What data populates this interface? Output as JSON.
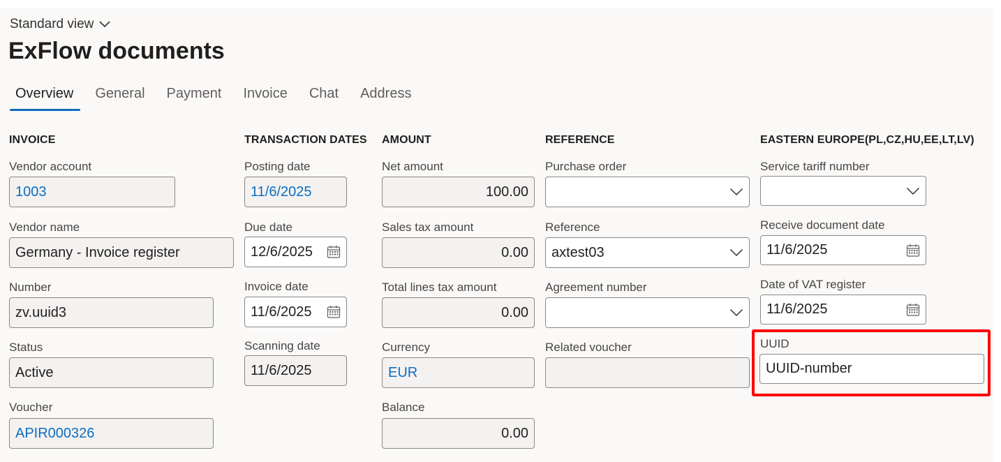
{
  "view": {
    "label": "Standard view",
    "icon": "chevron-down-icon"
  },
  "page_title": "ExFlow documents",
  "tabs": [
    "Overview",
    "General",
    "Payment",
    "Invoice",
    "Chat",
    "Address"
  ],
  "active_tab": "Overview",
  "sections": {
    "invoice": "INVOICE",
    "transaction_dates": "TRANSACTION DATES",
    "amount": "AMOUNT",
    "reference": "REFERENCE",
    "eastern_europe": "EASTERN EUROPE(PL,CZ,HU,EE,LT,LV)"
  },
  "invoice": {
    "vendor_account": {
      "label": "Vendor account",
      "value": "1003"
    },
    "vendor_name": {
      "label": "Vendor name",
      "value": "Germany - Invoice register"
    },
    "number": {
      "label": "Number",
      "value": "zv.uuid3"
    },
    "status": {
      "label": "Status",
      "value": "Active"
    },
    "voucher": {
      "label": "Voucher",
      "value": "APIR000326"
    }
  },
  "dates": {
    "posting_date": {
      "label": "Posting date",
      "value": "11/6/2025"
    },
    "due_date": {
      "label": "Due date",
      "value": "12/6/2025"
    },
    "invoice_date": {
      "label": "Invoice date",
      "value": "11/6/2025"
    },
    "scanning_date": {
      "label": "Scanning date",
      "value": "11/6/2025"
    }
  },
  "amount": {
    "net_amount": {
      "label": "Net amount",
      "value": "100.00"
    },
    "sales_tax_amount": {
      "label": "Sales tax amount",
      "value": "0.00"
    },
    "total_lines_tax_amount": {
      "label": "Total lines tax amount",
      "value": "0.00"
    },
    "currency": {
      "label": "Currency",
      "value": "EUR"
    },
    "balance": {
      "label": "Balance",
      "value": "0.00"
    }
  },
  "reference": {
    "purchase_order": {
      "label": "Purchase order",
      "value": ""
    },
    "reference": {
      "label": "Reference",
      "value": "axtest03"
    },
    "agreement_number": {
      "label": "Agreement number",
      "value": ""
    },
    "related_voucher": {
      "label": "Related voucher",
      "value": ""
    }
  },
  "eastern": {
    "service_tariff_number": {
      "label": "Service tariff number",
      "value": ""
    },
    "receive_document_date": {
      "label": "Receive document date",
      "value": "11/6/2025"
    },
    "date_of_vat_register": {
      "label": "Date of VAT register",
      "value": "11/6/2025"
    },
    "uuid": {
      "label": "UUID",
      "value": "UUID-number"
    }
  },
  "colors": {
    "accent": "#0f6cbd",
    "highlight": "#ff0000",
    "background": "#faf9f8",
    "readonly_field": "#f3f2f1"
  }
}
